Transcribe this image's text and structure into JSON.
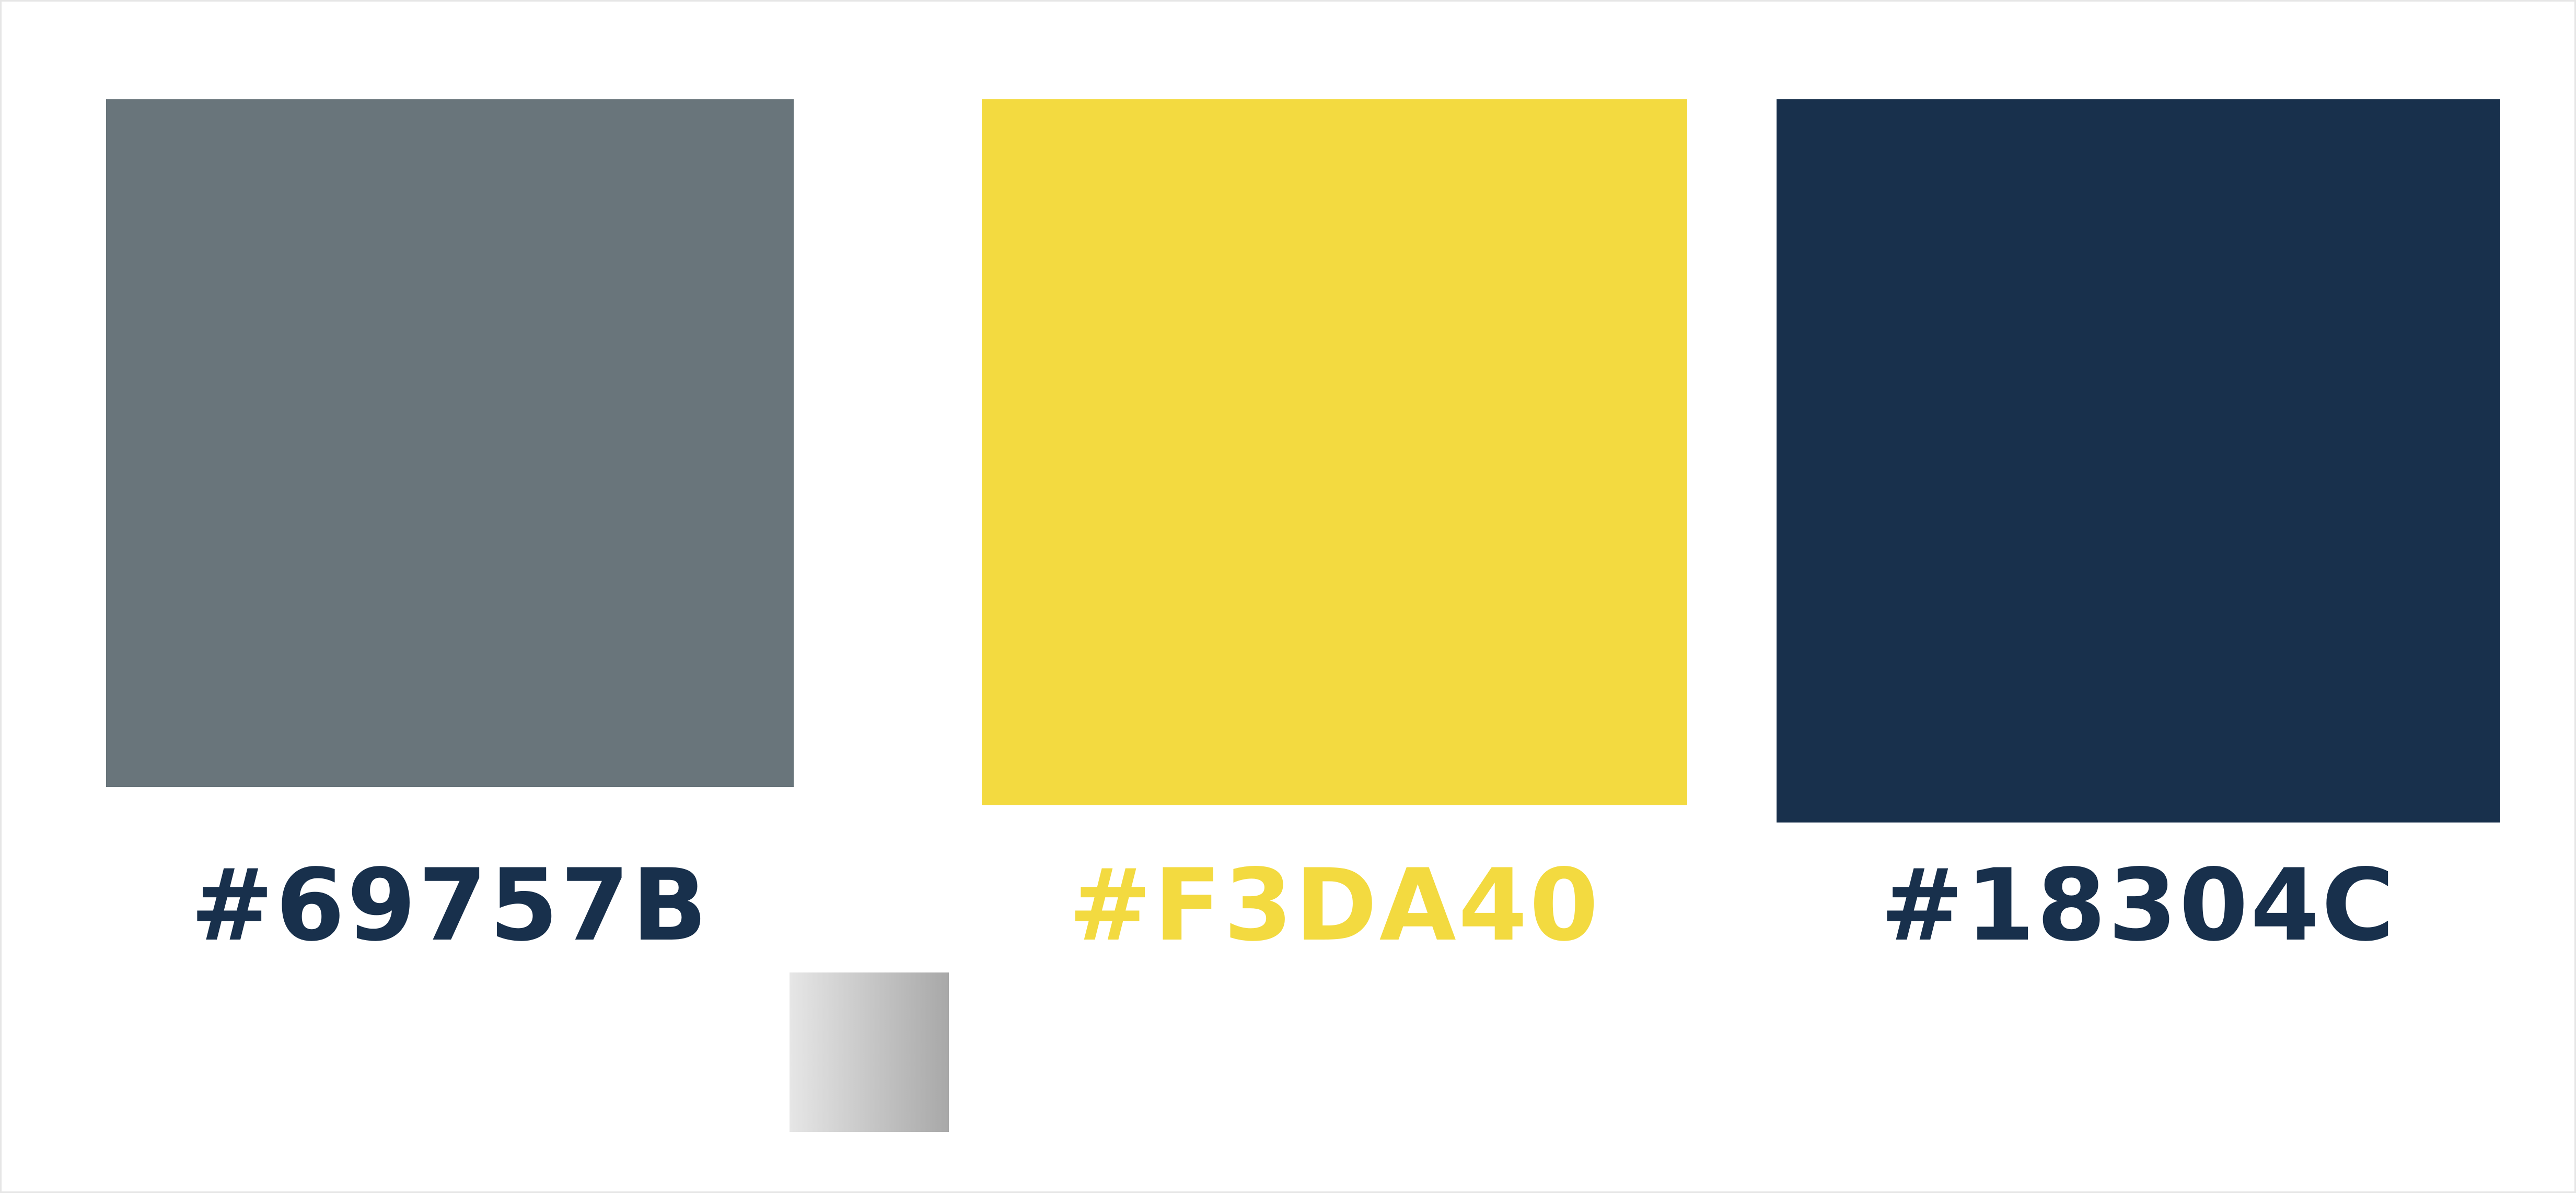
{
  "swatches": [
    {
      "id": "gray",
      "hex_label": "#69757B",
      "fill": "#69757B",
      "label_color": "#18304C"
    },
    {
      "id": "yellow",
      "hex_label": "#F3DA40",
      "fill": "#F3DA40",
      "label_color": "#F3DA40"
    },
    {
      "id": "navy",
      "hex_label": "#18304C",
      "fill": "#18304C",
      "label_color": "#18304C"
    }
  ],
  "gradient_chip": {
    "from": "#e6e6e6",
    "to": "#a8a8a8"
  }
}
